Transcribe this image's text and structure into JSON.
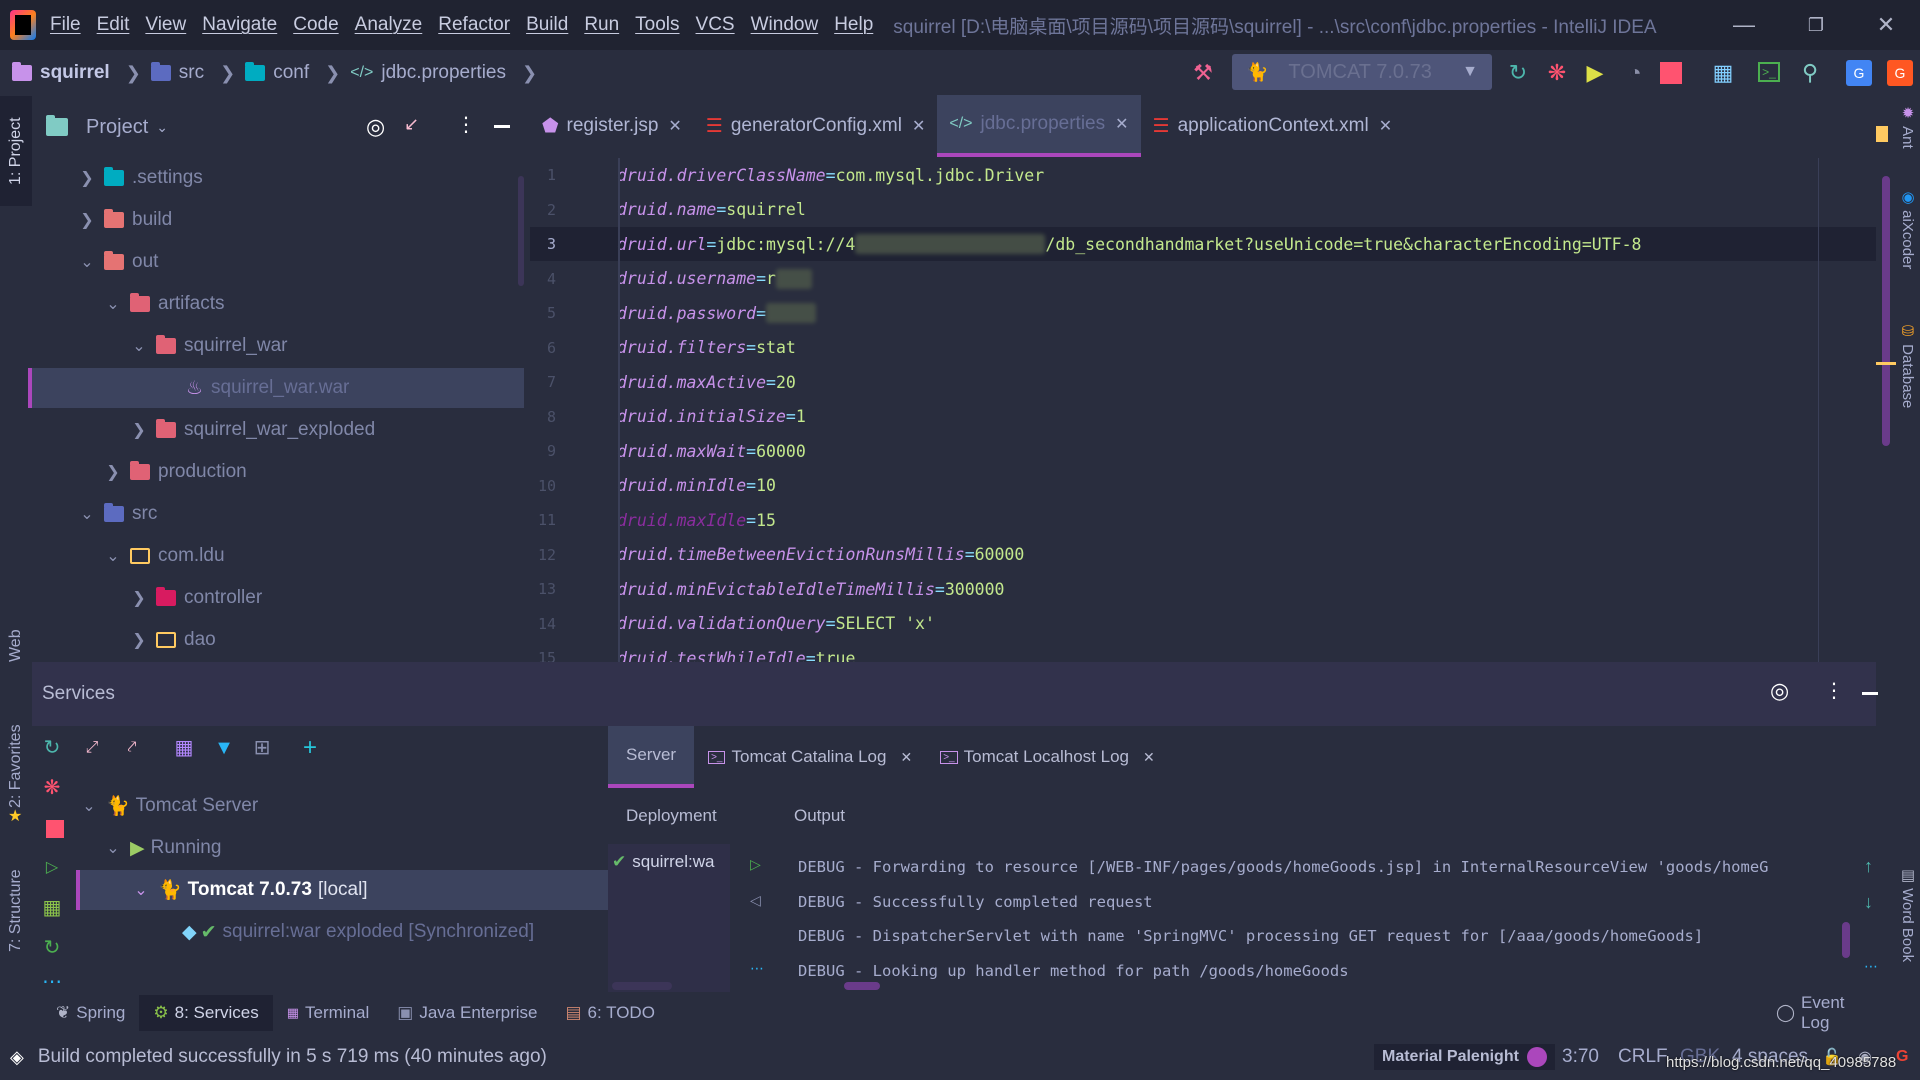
{
  "window": {
    "title": "squirrel [D:\\电脑桌面\\项目源码\\项目源码\\squirrel] - ...\\src\\conf\\jdbc.properties - IntelliJ IDEA",
    "controls": [
      "minimize",
      "restore",
      "close"
    ]
  },
  "menu": [
    "File",
    "Edit",
    "View",
    "Navigate",
    "Code",
    "Analyze",
    "Refactor",
    "Build",
    "Run",
    "Tools",
    "VCS",
    "Window",
    "Help"
  ],
  "breadcrumb": [
    "squirrel",
    "src",
    "conf",
    "jdbc.properties"
  ],
  "toolbar": {
    "run_config": "TOMCAT 7.0.73",
    "icons": [
      "hammer-icon",
      "rerun-icon",
      "debug-icon",
      "run-coverage-icon",
      "profiler-icon",
      "stop-icon",
      "structure-grid-icon",
      "terminal-icon",
      "search-icon",
      "google-translate-icon",
      "google-translate-alt-icon"
    ]
  },
  "left_strip": {
    "top": "1: Project",
    "web": "Web",
    "favorites": "2: Favorites",
    "structure": "7: Structure"
  },
  "right_strip": [
    "Ant",
    "aiXcoder",
    "Database",
    "Word Book"
  ],
  "project": {
    "title": "Project",
    "tree": [
      {
        "label": ".settings",
        "level": 1,
        "expanded": false,
        "icon": "settings-folder"
      },
      {
        "label": "build",
        "level": 1,
        "expanded": false,
        "icon": "excluded-folder"
      },
      {
        "label": "out",
        "level": 1,
        "expanded": true,
        "icon": "excluded-folder"
      },
      {
        "label": "artifacts",
        "level": 2,
        "expanded": true,
        "icon": "red-folder"
      },
      {
        "label": "squirrel_war",
        "level": 3,
        "expanded": true,
        "icon": "red-folder"
      },
      {
        "label": "squirrel_war.war",
        "level": 4,
        "selected": true,
        "icon": "war-file"
      },
      {
        "label": "squirrel_war_exploded",
        "level": 3,
        "expanded": false,
        "icon": "red-folder"
      },
      {
        "label": "production",
        "level": 2,
        "expanded": false,
        "icon": "red-folder"
      },
      {
        "label": "src",
        "level": 1,
        "expanded": true,
        "icon": "source-folder"
      },
      {
        "label": "com.ldu",
        "level": 2,
        "expanded": true,
        "icon": "package-folder"
      },
      {
        "label": "controller",
        "level": 3,
        "expanded": false,
        "icon": "controller-folder"
      },
      {
        "label": "dao",
        "level": 3,
        "expanded": false,
        "icon": "package-folder"
      }
    ]
  },
  "editor": {
    "tabs": [
      {
        "label": "register.jsp",
        "active": false
      },
      {
        "label": "generatorConfig.xml",
        "active": false
      },
      {
        "label": "jdbc.properties",
        "active": true
      },
      {
        "label": "applicationContext.xml",
        "active": false
      }
    ],
    "current_line": 3,
    "lines": [
      {
        "n": "1",
        "key": "druid.driverClassName",
        "value": "com.mysql.jdbc.Driver"
      },
      {
        "n": "2",
        "key": "druid.name",
        "value": "squirrel"
      },
      {
        "n": "3",
        "key": "druid.url",
        "value": "jdbc:mysql://4",
        "redacted": true,
        "value_after": "/db_secondhandmarket?useUnicode=true&characterEncoding=UTF-8"
      },
      {
        "n": "4",
        "key": "druid.username",
        "value": "r",
        "redacted": true,
        "value_after": ""
      },
      {
        "n": "5",
        "key": "druid.password",
        "value": "",
        "redacted": true,
        "value_after": ""
      },
      {
        "n": "6",
        "key": "druid.filters",
        "value": "stat"
      },
      {
        "n": "7",
        "key": "druid.maxActive",
        "value": "20"
      },
      {
        "n": "8",
        "key": "druid.initialSize",
        "value": "1"
      },
      {
        "n": "9",
        "key": "druid.maxWait",
        "value": "60000"
      },
      {
        "n": "10",
        "key": "druid.minIdle",
        "value": "10"
      },
      {
        "n": "11",
        "key": "druid.maxIdle",
        "value": "15",
        "dim": true
      },
      {
        "n": "12",
        "key": "druid.timeBetweenEvictionRunsMillis",
        "value": "60000"
      },
      {
        "n": "13",
        "key": "druid.minEvictableIdleTimeMillis",
        "value": "300000"
      },
      {
        "n": "14",
        "key": "druid.validationQuery",
        "value": "SELECT 'x'"
      },
      {
        "n": "15",
        "key": "druid.testWhileIdle",
        "value": "true"
      }
    ]
  },
  "services": {
    "title": "Services",
    "tree": [
      {
        "label": "Tomcat Server",
        "level": 0
      },
      {
        "label": "Running",
        "level": 1
      },
      {
        "label": "Tomcat 7.0.73",
        "suffix": "[local]",
        "level": 2,
        "selected": true
      },
      {
        "label": "squirrel:war exploded [Synchronized]",
        "level": 3
      }
    ],
    "tabs": [
      {
        "label": "Server",
        "active": true
      },
      {
        "label": "Tomcat Catalina Log",
        "closable": true
      },
      {
        "label": "Tomcat Localhost Log",
        "closable": true
      }
    ],
    "deployment_label": "Deployment",
    "output_label": "Output",
    "deployment_item": "squirrel:wa",
    "log": [
      "DEBUG - Forwarding to resource [/WEB-INF/pages/goods/homeGoods.jsp] in InternalResourceView 'goods/homeG",
      "DEBUG - Successfully completed request",
      "DEBUG - DispatcherServlet with name 'SpringMVC' processing GET request for [/aaa/goods/homeGoods]",
      "DEBUG - Looking up handler method for path /goods/homeGoods"
    ]
  },
  "bottom_tabs": [
    {
      "label": "Spring"
    },
    {
      "label": "8: Services",
      "active": true
    },
    {
      "label": "Terminal"
    },
    {
      "label": "Java Enterprise"
    },
    {
      "label": "6: TODO"
    }
  ],
  "event_log": "Event Log",
  "status": {
    "message": "Build completed successfully in 5 s 719 ms (40 minutes ago)",
    "theme": "Material Palenight",
    "position": "3:70",
    "line_sep": "CRLF",
    "encoding": "GBK",
    "indent": "4 spaces",
    "watermark": "https://blog.csdn.net/qq_40985788"
  },
  "colors": {
    "accent": "#AB47BC",
    "background": "#292D3E",
    "titlebar": "#202331",
    "key": "#C792EA",
    "value": "#C3E88D",
    "operator": "#89DDFF"
  }
}
